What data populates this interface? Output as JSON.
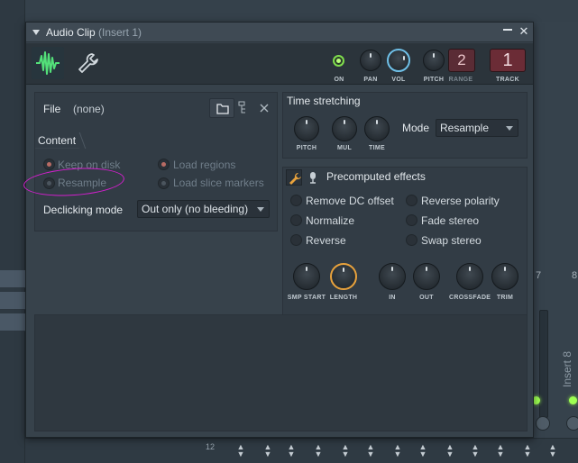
{
  "window": {
    "title": "Audio Clip",
    "subtitle": "(Insert 1)",
    "close_glyph": "✕"
  },
  "toolbar": {
    "knobs": {
      "on_label": "ON",
      "pan_label": "PAN",
      "vol_label": "VOL",
      "pitch_label": "PITCH",
      "range_label": "RANGE",
      "track_label": "TRACK"
    },
    "pitch_range_value": "2",
    "track_value": "1"
  },
  "file": {
    "label": "File",
    "value": "(none)"
  },
  "content": {
    "tab_label": "Content",
    "options": {
      "keep_on_disk": "Keep on disk",
      "resample": "Resample",
      "load_regions": "Load regions",
      "load_slice_markers": "Load slice markers"
    },
    "declicking_label": "Declicking mode",
    "declicking_value": "Out only (no bleeding)"
  },
  "time_stretching": {
    "title": "Time stretching",
    "knobs": {
      "pitch": "PITCH",
      "mul": "MUL",
      "time": "TIME"
    },
    "mode_label": "Mode",
    "mode_value": "Resample"
  },
  "effects": {
    "title": "Precomputed effects",
    "options": {
      "remove_dc": "Remove DC offset",
      "reverse_polarity": "Reverse polarity",
      "normalize": "Normalize",
      "fade_stereo": "Fade stereo",
      "reverse": "Reverse",
      "swap_stereo": "Swap stereo"
    },
    "knobs": {
      "smp_start": "SMP START",
      "length": "LENGTH",
      "in": "IN",
      "out": "OUT",
      "crossfade": "CROSSFADE",
      "trim": "TRIM"
    }
  },
  "background": {
    "strip_7": "7",
    "strip_8": "8",
    "insert_label": "Insert 8",
    "row_number": "12"
  },
  "colors": {
    "accent_green": "#7fdd4d",
    "accent_orange": "#e8a23c",
    "accent_blue": "#6fc0e8",
    "annotation_magenta": "#d51fcf",
    "track_red": "#6b2c36"
  },
  "icons": {
    "waveform_tab": "waveform-icon",
    "settings_tab": "wrench-icon",
    "open_file": "folder-icon",
    "file_tree": "tree-icon",
    "clear_file": "close-icon"
  }
}
